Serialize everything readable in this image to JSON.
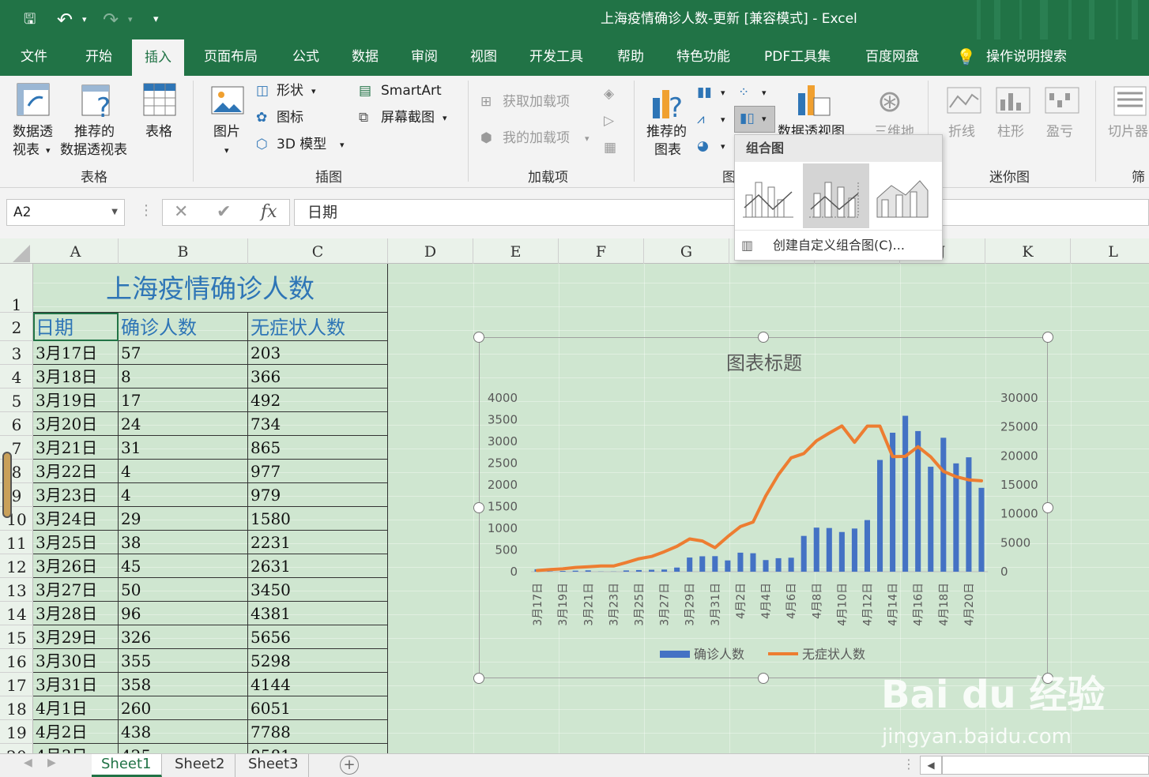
{
  "window": {
    "title": "上海疫情确诊人数-更新  [兼容模式]  -  Excel",
    "quick_access": {
      "save": "🖫",
      "undo": "↶",
      "redo": "↷",
      "customize": "▾"
    }
  },
  "tabs": [
    "文件",
    "开始",
    "插入",
    "页面布局",
    "公式",
    "数据",
    "审阅",
    "视图",
    "开发工具",
    "帮助",
    "特色功能",
    "PDF工具集",
    "百度网盘",
    "操作说明搜索"
  ],
  "active_tab": "插入",
  "ribbon": {
    "tables": {
      "pivot_l1": "数据透",
      "pivot_l2": "视表",
      "recommended_l1": "推荐的",
      "recommended_l2": "数据透视表",
      "table": "表格",
      "group": "表格"
    },
    "illustrations": {
      "picture": "图片",
      "shapes": "形状",
      "icons": "图标",
      "model3d": "3D 模型",
      "smartart": "SmartArt",
      "screenshot": "屏幕截图",
      "group": "插图"
    },
    "addins": {
      "get": "获取加载项",
      "my": "我的加载项",
      "group": "加载项"
    },
    "charts": {
      "recommended_l1": "推荐的",
      "recommended_l2": "图表",
      "pivotchart": "数据透视图",
      "group": "图"
    },
    "tours": {
      "map3d": "三维地"
    },
    "sparklines": {
      "line": "折线",
      "column": "柱形",
      "winloss": "盈亏",
      "group": "迷你图"
    },
    "filters": {
      "slicer": "切片器",
      "group": "筛"
    }
  },
  "formula_bar": {
    "name_box": "A2",
    "cancel": "✕",
    "enter": "✔",
    "fx": "fx",
    "content": "日期"
  },
  "columns": [
    "A",
    "B",
    "C",
    "D",
    "E",
    "F",
    "G",
    "H",
    "I",
    "J",
    "K",
    "L"
  ],
  "rows": [
    "1",
    "2",
    "3",
    "4",
    "5",
    "6",
    "7",
    "8",
    "9",
    "10",
    "11",
    "12",
    "13",
    "14",
    "15",
    "16",
    "17",
    "18",
    "19",
    "20"
  ],
  "table": {
    "title": "上海疫情确诊人数",
    "headers": [
      "日期",
      "确诊人数",
      "无症状人数"
    ],
    "rows": [
      [
        "3月17日",
        "57",
        "203"
      ],
      [
        "3月18日",
        "8",
        "366"
      ],
      [
        "3月19日",
        "17",
        "492"
      ],
      [
        "3月20日",
        "24",
        "734"
      ],
      [
        "3月21日",
        "31",
        "865"
      ],
      [
        "3月22日",
        "4",
        "977"
      ],
      [
        "3月23日",
        "4",
        "979"
      ],
      [
        "3月24日",
        "29",
        "1580"
      ],
      [
        "3月25日",
        "38",
        "2231"
      ],
      [
        "3月26日",
        "45",
        "2631"
      ],
      [
        "3月27日",
        "50",
        "3450"
      ],
      [
        "3月28日",
        "96",
        "4381"
      ],
      [
        "3月29日",
        "326",
        "5656"
      ],
      [
        "3月30日",
        "355",
        "5298"
      ],
      [
        "3月31日",
        "358",
        "4144"
      ],
      [
        "4月1日",
        "260",
        "6051"
      ],
      [
        "4月2日",
        "438",
        "7788"
      ],
      [
        "4月3日",
        "425",
        "8581"
      ]
    ]
  },
  "combo_dropdown": {
    "header": "组合图",
    "custom": "创建自定义组合图(C)..."
  },
  "sheet_tabs": [
    "Sheet1",
    "Sheet2",
    "Sheet3"
  ],
  "active_sheet": "Sheet1",
  "watermark": {
    "logo": "Bai du 经验",
    "url": "jingyan.baidu.com"
  },
  "chart_data": {
    "type": "bar",
    "title": "图表标题",
    "categories": [
      "3月17日",
      "3月18日",
      "3月19日",
      "3月20日",
      "3月21日",
      "3月22日",
      "3月23日",
      "3月24日",
      "3月25日",
      "3月26日",
      "3月27日",
      "3月28日",
      "3月29日",
      "3月30日",
      "3月31日",
      "4月1日",
      "4月2日",
      "4月3日",
      "4月4日",
      "4月5日",
      "4月6日",
      "4月7日",
      "4月8日",
      "4月9日",
      "4月10日",
      "4月11日",
      "4月12日",
      "4月13日",
      "4月14日",
      "4月15日",
      "4月16日",
      "4月17日",
      "4月18日",
      "4月19日",
      "4月20日",
      "4月21日"
    ],
    "x_tick_labels": [
      "3月17日",
      "3月19日",
      "3月21日",
      "3月23日",
      "3月25日",
      "3月27日",
      "3月29日",
      "3月31日",
      "4月2日",
      "4月4日",
      "4月6日",
      "4月8日",
      "4月10日",
      "4月12日",
      "4月14日",
      "4月16日",
      "4月18日",
      "4月20日"
    ],
    "series": [
      {
        "name": "确诊人数",
        "type": "bar",
        "axis": "left",
        "color": "#4472c4",
        "values": [
          57,
          8,
          17,
          24,
          31,
          4,
          4,
          29,
          38,
          45,
          50,
          96,
          326,
          355,
          358,
          260,
          438,
          425,
          268,
          311,
          322,
          824,
          1015,
          1006,
          914,
          994,
          1189,
          2573,
          3200,
          3590,
          3238,
          2417,
          3084,
          2494,
          2634,
          1931
        ]
      },
      {
        "name": "无症状人数",
        "type": "line",
        "axis": "right",
        "color": "#ed7d31",
        "values": [
          203,
          366,
          492,
          734,
          865,
          977,
          979,
          1580,
          2231,
          2631,
          3450,
          4381,
          5656,
          5298,
          4144,
          6051,
          7788,
          8581,
          13086,
          16766,
          19660,
          20398,
          22609,
          23937,
          25173,
          22348,
          25141,
          25146,
          19872,
          19923,
          21582,
          19831,
          17332,
          16407,
          15861,
          15698
        ]
      }
    ],
    "y_left": {
      "ylim": [
        0,
        4000
      ],
      "ticks": [
        0,
        500,
        1000,
        1500,
        2000,
        2500,
        3000,
        3500,
        4000
      ]
    },
    "y_right": {
      "ylim": [
        0,
        30000
      ],
      "ticks": [
        0,
        5000,
        10000,
        15000,
        20000,
        25000,
        30000
      ]
    },
    "legend": "bottom",
    "grid": false
  }
}
